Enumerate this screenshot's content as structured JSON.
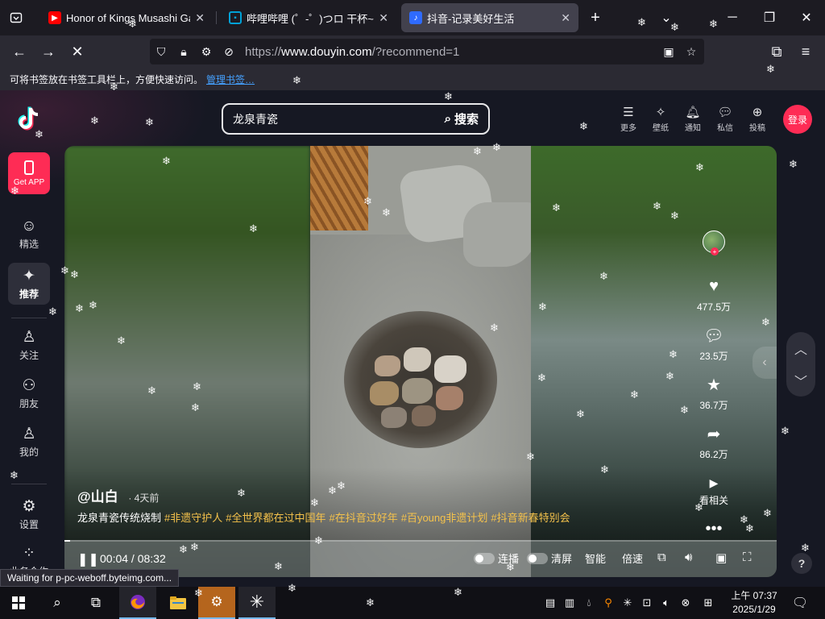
{
  "browser": {
    "tabs": [
      {
        "title": "Honor of Kings Musashi Gam",
        "icon": "youtube-icon",
        "color": "#ff0000",
        "active": false
      },
      {
        "title": "哔哩哔哩 (゜-゜)つロ 干杯~-bili",
        "icon": "bilibili-icon",
        "color": "#00a1d6",
        "active": false
      },
      {
        "title": "抖音-记录美好生活",
        "icon": "douyin-icon",
        "color": "#2f6bff",
        "active": true
      }
    ],
    "new_tab_label": "+",
    "url_host": "www.douyin.com",
    "url_prefix": "https://",
    "url_path": "/?recommend=1",
    "bookmarks_hint": "可将书签放在书签工具栏上，方便快速访问。",
    "bookmarks_link": "管理书签…",
    "status_tip": "Waiting for p-pc-weboff.byteimg.com..."
  },
  "header": {
    "search_value": "龙泉青瓷",
    "search_button": "搜索",
    "actions": [
      {
        "label": "更多",
        "icon": "menu-icon"
      },
      {
        "label": "壁纸",
        "icon": "wallpaper-icon"
      },
      {
        "label": "通知",
        "icon": "bell-icon"
      },
      {
        "label": "私信",
        "icon": "message-icon"
      },
      {
        "label": "投稿",
        "icon": "upload-icon"
      }
    ],
    "login_label": "登录"
  },
  "sidebar": {
    "get_app": "Get APP",
    "items": [
      {
        "label": "精选",
        "icon": "featured-icon"
      },
      {
        "label": "推荐",
        "icon": "sparkle-icon",
        "active": true
      },
      {
        "label": "关注",
        "icon": "follow-icon"
      },
      {
        "label": "朋友",
        "icon": "friends-icon"
      },
      {
        "label": "我的",
        "icon": "profile-icon"
      },
      {
        "label": "设置",
        "icon": "settings-icon"
      },
      {
        "label": "业务合作",
        "icon": "business-icon"
      }
    ]
  },
  "video": {
    "author": "@山白",
    "posted": "· 4天前",
    "description": "龙泉青瓷传统烧制",
    "tags": [
      "#非遗守护人",
      "#全世界都在过中国年",
      "#在抖音过好年",
      "#百young非遗计划",
      "#抖音新春特别会"
    ],
    "likes": "477.5万",
    "comments": "23.5万",
    "favorites": "36.7万",
    "shares": "86.2万",
    "related_label": "看相关",
    "current_time": "00:04",
    "duration": "08:32",
    "progress": 0.008,
    "controls": {
      "autoplay": "连播",
      "clear": "清屏",
      "quality": "智能",
      "speed": "倍速"
    }
  },
  "taskbar": {
    "time": "上午 07:37",
    "date": "2025/1/29"
  }
}
